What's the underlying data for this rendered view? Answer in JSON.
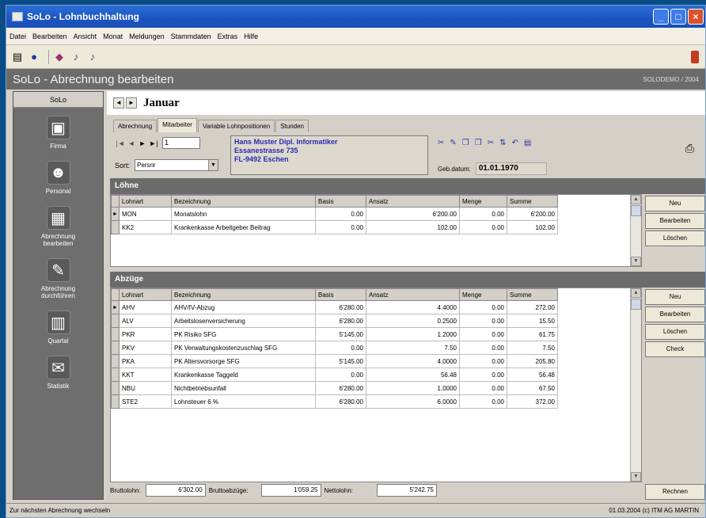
{
  "window": {
    "title": "SoLo - Lohnbuchhaltung"
  },
  "menu": [
    "Datei",
    "Bearbeiten",
    "Ansicht",
    "Monat",
    "Meldungen",
    "Stammdaten",
    "Extras",
    "Hilfe"
  ],
  "header": {
    "title": "SoLo - Abrechnung bearbeiten",
    "right": "SOLODEMO / 2004"
  },
  "sidebar": {
    "title": "SoLo",
    "items": [
      {
        "label": "Firma",
        "icon": "company-icon"
      },
      {
        "label": "Personal",
        "icon": "personnel-icon"
      },
      {
        "label": "Abrechnung bearbeiten",
        "icon": "edit-payroll-icon"
      },
      {
        "label": "Abrechnung durchführen",
        "icon": "run-payroll-icon"
      },
      {
        "label": "Quartal",
        "icon": "quarter-icon"
      },
      {
        "label": "Statistik",
        "icon": "statistics-icon"
      }
    ]
  },
  "month": "Januar",
  "tabs": [
    "Abrechnung",
    "Mitarbeiter",
    "Variable Lohnpositionen",
    "Stunden"
  ],
  "employee": {
    "record": "1",
    "sort_label": "Sort:",
    "sort_value": "Persnr",
    "address": [
      "Hans Muster Dipl. Informatiker",
      "Essanestrasse 735",
      "FL-9492 Eschen"
    ],
    "geb_label": "Geb.datum:",
    "geb_value": "01.01.1970"
  },
  "loehne": {
    "title": "Löhne",
    "columns": [
      "Lohnart",
      "Bezeichnung",
      "Basis",
      "Ansatz",
      "Menge",
      "Summe"
    ],
    "rows": [
      [
        "MON",
        "Monatslohn",
        "0.00",
        "6'200.00",
        "0.00",
        "6'200.00"
      ],
      [
        "KK2",
        "Krankenkasse Arbeitgeber Beitrag",
        "0.00",
        "102.00",
        "0.00",
        "102.00"
      ]
    ],
    "buttons": [
      "Neu",
      "Bearbeiten",
      "Löschen"
    ]
  },
  "abzuege": {
    "title": "Abzüge",
    "columns": [
      "Lohnart",
      "Bezeichnung",
      "Basis",
      "Ansatz",
      "Menge",
      "Summe"
    ],
    "rows": [
      [
        "AHV",
        "AHV/IV-Abzug",
        "6'280.00",
        "4.4000",
        "0.00",
        "272.00"
      ],
      [
        "ALV",
        "Arbeitslosenversicherung",
        "6'280.00",
        "0.2500",
        "0.00",
        "15.50"
      ],
      [
        "PKR",
        "PK Risiko SFG",
        "5'145.00",
        "1.2000",
        "0.00",
        "61.75"
      ],
      [
        "PKV",
        "PK Verwaltungskostenzuschlag SFG",
        "0.00",
        "7.50",
        "0.00",
        "7.50"
      ],
      [
        "PKA",
        "PK Altersvorsorge SFG",
        "5'145.00",
        "4.0000",
        "0.00",
        "205.80"
      ],
      [
        "KKT",
        "Krankenkasse Taggeld",
        "0.00",
        "56.48",
        "0.00",
        "56.48"
      ],
      [
        "NBU",
        "Nichtbetriebsunfall",
        "6'280.00",
        "1.0000",
        "0.00",
        "67.50"
      ],
      [
        "STE2",
        "Lohnsteuer 6 %",
        "6'280.00",
        "6.0000",
        "0.00",
        "372.00"
      ]
    ],
    "buttons": [
      "Neu",
      "Bearbeiten",
      "Löschen",
      "Check"
    ]
  },
  "totals": {
    "brutto_label": "Bruttolohn:",
    "brutto": "6'302.00",
    "abzuege_label": "Bruttoabzüge:",
    "abzuege": "1'059.25",
    "netto_label": "Nettolohn:",
    "netto": "5'242.75",
    "rechnen_label": "Rechnen"
  },
  "status": {
    "left": "Zur nächsten Abrechnung wechseln",
    "right": "01.03.2004   (c) ITM AG   MARTIN"
  }
}
